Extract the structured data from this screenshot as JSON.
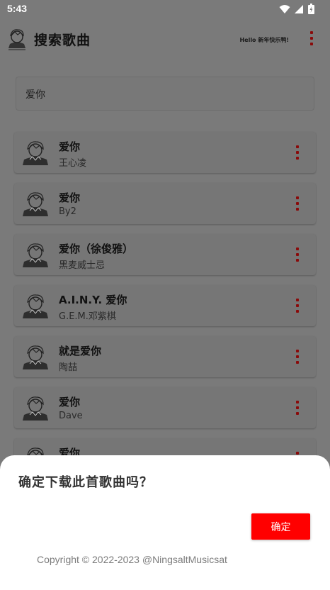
{
  "status_bar": {
    "time": "5:43",
    "icons": [
      "wifi-icon",
      "signal-icon",
      "battery-icon"
    ]
  },
  "app_bar": {
    "title": "搜索歌曲",
    "greeting": "Hello 新年快乐鸭!",
    "menu_icon": "more-vert-icon"
  },
  "search": {
    "value": "爱你"
  },
  "songs": [
    {
      "title": "爱你",
      "artist": "王心凌"
    },
    {
      "title": "爱你",
      "artist": "By2"
    },
    {
      "title": "爱你（徐俊雅）",
      "artist": "黑麦威士忌"
    },
    {
      "title": "A.I.N.Y. 爱你",
      "artist": "G.E.M.邓紫棋"
    },
    {
      "title": "就是爱你",
      "artist": "陶喆"
    },
    {
      "title": "爱你",
      "artist": "Dave"
    },
    {
      "title": "爱你",
      "artist": ""
    }
  ],
  "dialog": {
    "title": "确定下载此首歌曲吗？",
    "confirm_label": "确定",
    "copyright": "Copyright © 2022-2023 @NingsaltMusicsat"
  },
  "colors": {
    "accent": "#ff0000",
    "scrim": "#7a7a7a",
    "menu_dots": "#8a0a0a"
  }
}
